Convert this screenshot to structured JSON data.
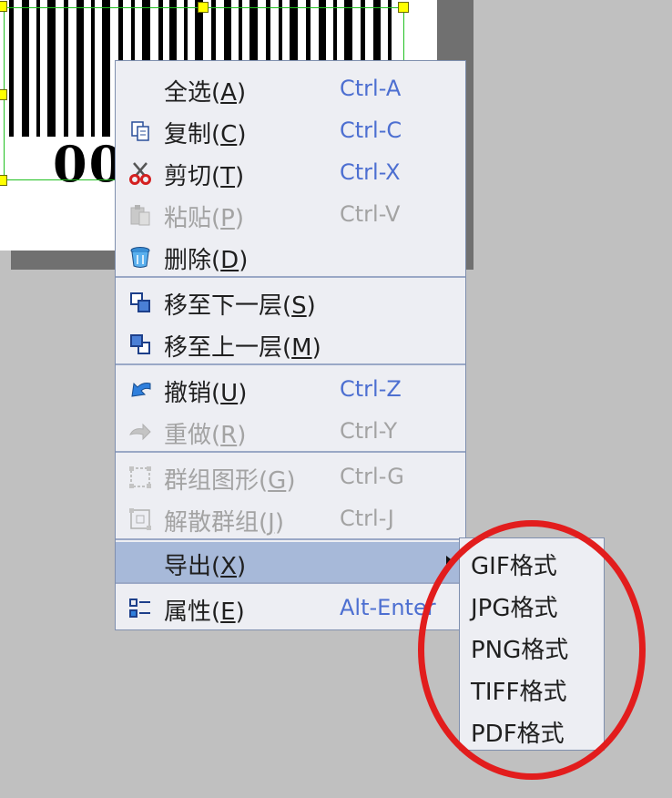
{
  "barcode": {
    "digits": "00"
  },
  "menu": {
    "items": [
      {
        "label": "全选(",
        "mnemonic": "A",
        "close": ")",
        "shortcut": "Ctrl-A",
        "icon": "none",
        "disabled": false
      },
      {
        "label": "复制(",
        "mnemonic": "C",
        "close": ")",
        "shortcut": "Ctrl-C",
        "icon": "copy-icon",
        "disabled": false
      },
      {
        "label": "剪切(",
        "mnemonic": "T",
        "close": ")",
        "shortcut": "Ctrl-X",
        "icon": "scissors-icon",
        "disabled": false
      },
      {
        "label": "粘贴(",
        "mnemonic": "P",
        "close": ")",
        "shortcut": "Ctrl-V",
        "icon": "paste-icon",
        "disabled": true
      },
      {
        "label": "删除(",
        "mnemonic": "D",
        "close": ")",
        "shortcut": "",
        "icon": "trash-icon",
        "disabled": false
      },
      {
        "label": "移至下一层(",
        "mnemonic": "S",
        "close": ")",
        "shortcut": "",
        "icon": "send-backward-icon",
        "disabled": false
      },
      {
        "label": "移至上一层(",
        "mnemonic": "M",
        "close": ")",
        "shortcut": "",
        "icon": "bring-forward-icon",
        "disabled": false
      },
      {
        "label": "撤销(",
        "mnemonic": "U",
        "close": ")",
        "shortcut": "Ctrl-Z",
        "icon": "undo-icon",
        "disabled": false
      },
      {
        "label": "重做(",
        "mnemonic": "R",
        "close": ")",
        "shortcut": "Ctrl-Y",
        "icon": "redo-icon",
        "disabled": true
      },
      {
        "label": "群组图形(",
        "mnemonic": "G",
        "close": ")",
        "shortcut": "Ctrl-G",
        "icon": "group-icon",
        "disabled": true
      },
      {
        "label": "解散群组(",
        "mnemonic": "J",
        "close": ")",
        "shortcut": "Ctrl-J",
        "icon": "ungroup-icon",
        "disabled": true
      },
      {
        "label": "导出(",
        "mnemonic": "X",
        "close": ")",
        "shortcut": "",
        "icon": "none",
        "disabled": false,
        "active": true
      },
      {
        "label": "属性(",
        "mnemonic": "E",
        "close": ")",
        "shortcut": "Alt-Enter",
        "icon": "properties-icon",
        "disabled": false
      }
    ]
  },
  "submenu": {
    "items": [
      {
        "label": "GIF格式"
      },
      {
        "label": "JPG格式"
      },
      {
        "label": "PNG格式"
      },
      {
        "label": "TIFF格式"
      },
      {
        "label": "PDF格式"
      }
    ]
  },
  "colors": {
    "background": "#c0c0c0",
    "menu_bg": "#edeef3",
    "highlight": "#a7b9d9",
    "shortcut_text": "#4d6fd1",
    "disabled_text": "#a3a3a3",
    "annotation_circle": "#e21d1d",
    "selection_handles": "#ffff00"
  }
}
